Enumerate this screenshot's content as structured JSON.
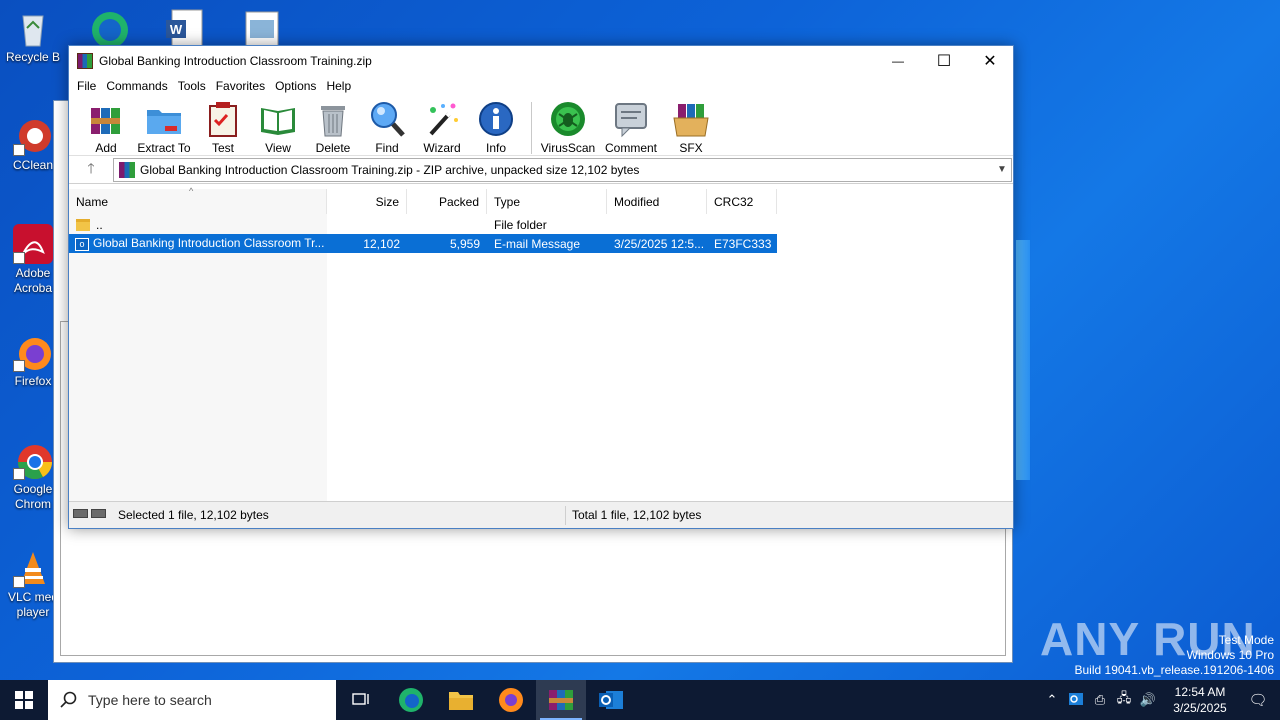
{
  "desktop": {
    "icons": [
      {
        "label": "Recycle B"
      },
      {
        "label": "CClean"
      },
      {
        "label": "Adobe Acroba"
      },
      {
        "label": "Firefox"
      },
      {
        "label": "Google Chrom"
      },
      {
        "label": "VLC med player"
      }
    ]
  },
  "window": {
    "title": "Global Banking Introduction Classroom Training.zip",
    "controls": {
      "minimize": "—",
      "maximize": "☐",
      "close": "✕"
    }
  },
  "menu": [
    "File",
    "Commands",
    "Tools",
    "Favorites",
    "Options",
    "Help"
  ],
  "toolbar": [
    {
      "label": "Add",
      "icon": "add-icon"
    },
    {
      "label": "Extract To",
      "icon": "extract-icon"
    },
    {
      "label": "Test",
      "icon": "test-icon"
    },
    {
      "label": "View",
      "icon": "view-icon"
    },
    {
      "label": "Delete",
      "icon": "delete-icon"
    },
    {
      "label": "Find",
      "icon": "find-icon"
    },
    {
      "label": "Wizard",
      "icon": "wizard-icon"
    },
    {
      "label": "Info",
      "icon": "info-icon"
    },
    {
      "label": "VirusScan",
      "icon": "virusscan-icon"
    },
    {
      "label": "Comment",
      "icon": "comment-icon"
    },
    {
      "label": "SFX",
      "icon": "sfx-icon"
    }
  ],
  "address": "Global Banking Introduction Classroom Training.zip - ZIP archive, unpacked size 12,102 bytes",
  "columns": [
    "Name",
    "Size",
    "Packed",
    "Type",
    "Modified",
    "CRC32"
  ],
  "rows": [
    {
      "name": "..",
      "size": "",
      "packed": "",
      "type": "File folder",
      "modified": "",
      "crc": "",
      "selected": false
    },
    {
      "name": "Global Banking Introduction Classroom Tr...",
      "size": "12,102",
      "packed": "5,959",
      "type": "E-mail Message",
      "modified": "3/25/2025 12:5...",
      "crc": "E73FC333",
      "selected": true
    }
  ],
  "status": {
    "left": "Selected 1 file, 12,102 bytes",
    "right": "Total 1 file, 12,102 bytes"
  },
  "watermark": {
    "line1": "Test Mode",
    "line2": "Windows 10 Pro",
    "line3": "Build 19041.vb_release.191206-1406",
    "brand": "ANY RUN"
  },
  "taskbar": {
    "search_placeholder": "Type here to search",
    "time": "12:54 AM",
    "date": "3/25/2025"
  }
}
